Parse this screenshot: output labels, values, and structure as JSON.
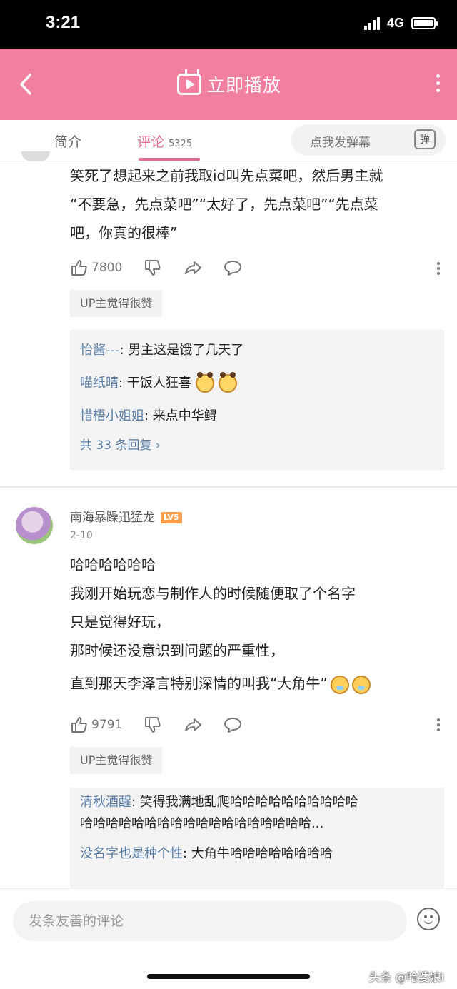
{
  "status_bar": {
    "time": "3:21",
    "network": "4G"
  },
  "header": {
    "title": "立即播放"
  },
  "tabs": {
    "intro": "简介",
    "comments": "评论",
    "comments_count": "5325",
    "danmaku_placeholder": "点我发弹幕",
    "danmaku_toggle": "弹"
  },
  "comments": [
    {
      "lines": [
        "笑死了想起来之前我取id叫先点菜吧，然后男主就",
        "“不要急，先点菜吧”“太好了，先点菜吧”“先点菜",
        "吧，你真的很棒”"
      ],
      "likes": "7800",
      "up_badge": "UP主觉得很赞",
      "replies": [
        {
          "user": "怡酱---",
          "text": ": 男主这是饿了几天了"
        },
        {
          "user": "喵纸晴",
          "text": ": 干饭人狂喜"
        },
        {
          "user": "惜梧小姐姐",
          "text": ": 来点中华鲟"
        }
      ],
      "reply_more": "共 33 条回复 ›"
    },
    {
      "user": "南海暴躁迅猛龙",
      "level": "LV5",
      "date": "2-10",
      "lines": [
        "哈哈哈哈哈哈",
        "我刚开始玩恋与制作人的时候随便取了个名字",
        "只是觉得好玩，",
        "那时候还没意识到问题的严重性，",
        "直到那天李泽言特别深情的叫我“大角牛”"
      ],
      "likes": "9791",
      "up_badge": "UP主觉得很赞",
      "replies": [
        {
          "user": "清秋酒醒",
          "text": ": 笑得我满地乱爬哈哈哈哈哈哈哈哈哈哈",
          "cont": "哈哈哈哈哈哈哈哈哈哈哈哈哈哈哈哈哈哈..."
        },
        {
          "user": "没名字也是种个性",
          "text": ": 大角牛哈哈哈哈哈哈哈哈"
        }
      ]
    }
  ],
  "input": {
    "placeholder": "发条友善的评论"
  },
  "watermark": "头条 @哈婆娘i"
}
